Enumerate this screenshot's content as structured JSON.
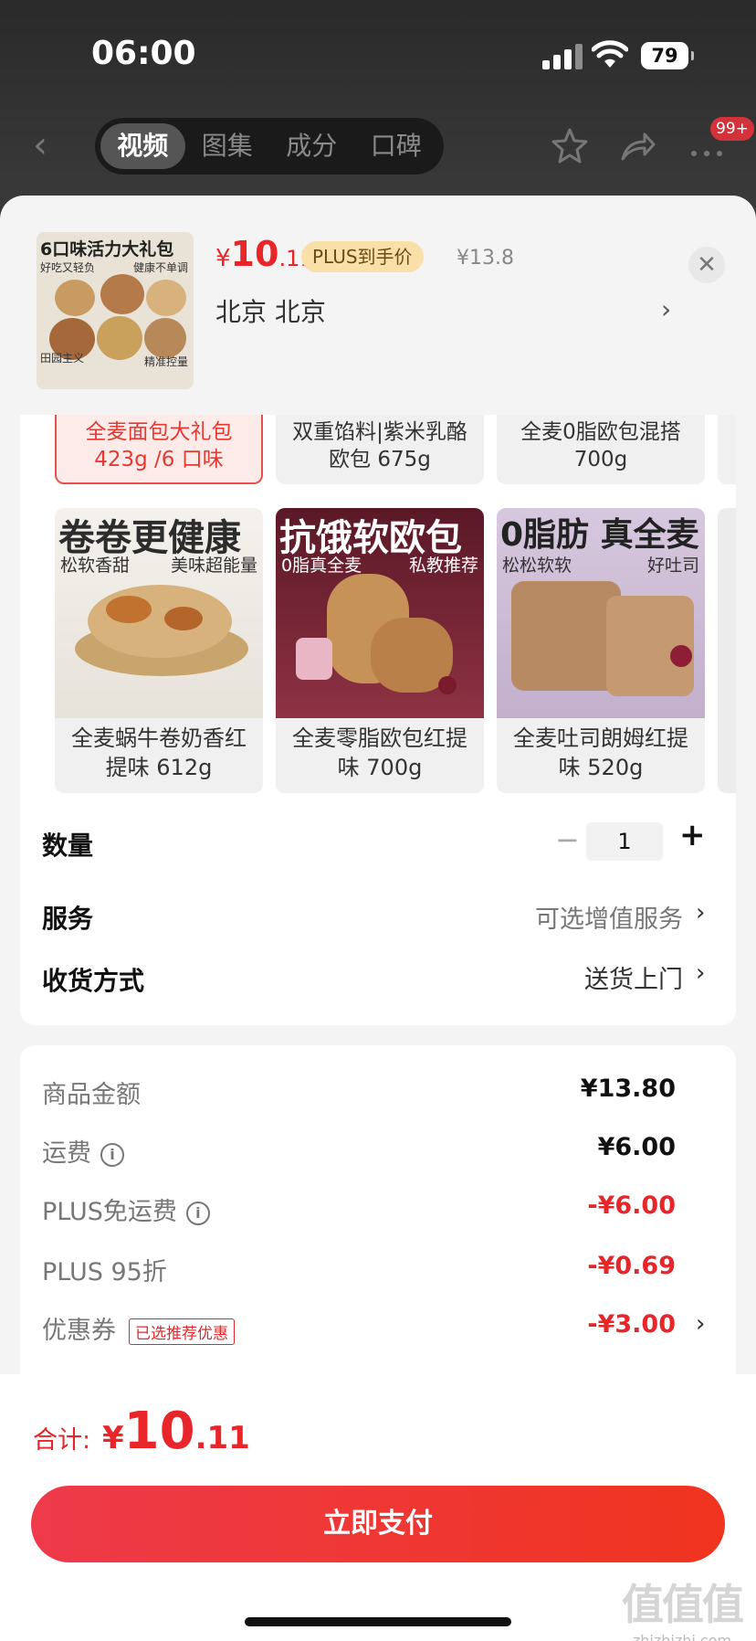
{
  "status": {
    "time": "06:00",
    "battery": "79"
  },
  "nav": {
    "tabs": [
      "视频",
      "图集",
      "成分",
      "口碑"
    ],
    "badge": "99+"
  },
  "product": {
    "thumb_title": "6口味活力大礼包",
    "thumb_sub_left": "好吃又轻负",
    "thumb_sub_right": "健康不单调",
    "thumb_brand": "田园主义",
    "thumb_tag": "精准控量",
    "price_currency": "¥",
    "price_int": "10",
    "price_dec": ".11",
    "plus_tag": "PLUS到手价",
    "price_original": "¥13.8",
    "address": "北京  北京"
  },
  "variants_top": [
    {
      "line1": "全麦面包大礼包",
      "line2": "423g /6 口味",
      "selected": true
    },
    {
      "line1": "双重馅料|紫米乳酪",
      "line2": "欧包 675g",
      "selected": false
    },
    {
      "line1": "全麦0脂欧包混搭",
      "line2": "700g",
      "selected": false
    }
  ],
  "variants": [
    {
      "headline": "卷卷更健康",
      "sub_left": "松软香甜",
      "sub_right": "美味超能量",
      "name_line1": "全麦蜗牛卷奶香红",
      "name_line2": "提味 612g"
    },
    {
      "headline": "抗饿软欧包",
      "sub_left": "0脂真全麦",
      "sub_right": "私教推荐",
      "name_line1": "全麦零脂欧包红提",
      "name_line2": "味 700g"
    },
    {
      "headline": "0脂肪 真全麦",
      "sub_left": "松松软软",
      "sub_right": "好吐司",
      "name_line1": "全麦吐司朗姆红提",
      "name_line2": "味 520g"
    }
  ],
  "options": {
    "quantity_label": "数量",
    "quantity_value": "1",
    "service_label": "服务",
    "service_value": "可选增值服务",
    "delivery_label": "收货方式",
    "delivery_value": "送货上门"
  },
  "breakdown": {
    "goods_label": "商品金额",
    "goods_value": "¥13.80",
    "shipping_label": "运费",
    "shipping_value": "¥6.00",
    "plus_free_label": "PLUS免运费",
    "plus_free_value": "-¥6.00",
    "plus_discount_label": "PLUS 95折",
    "plus_discount_value": "-¥0.69",
    "coupon_label": "优惠券",
    "coupon_tag": "已选推荐优惠",
    "coupon_value": "-¥3.00"
  },
  "footer": {
    "total_label": "合计:",
    "total_currency": "¥",
    "total_int": "10",
    "total_dec": ".11",
    "pay_button": "立即支付",
    "watermark_big": "值值值",
    "watermark_small": "zhizhizhi.com"
  },
  "colors": {
    "accent": "#e8262a",
    "plus_tag_bg": "#f9e0a8"
  }
}
